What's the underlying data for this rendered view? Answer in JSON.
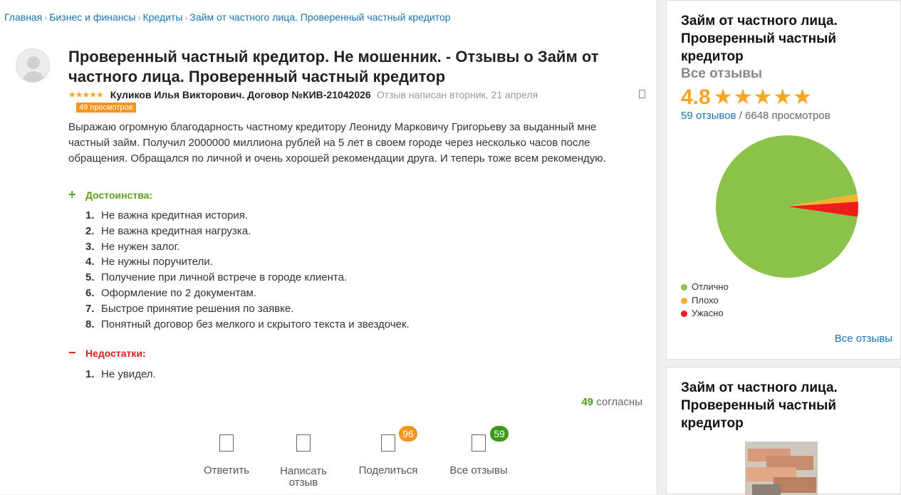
{
  "breadcrumb": [
    "Главная",
    "Бизнес и финансы",
    "Кредиты",
    "Займ от частного лица. Проверенный частный кредитор"
  ],
  "review": {
    "title": "Проверенный частный кредитор. Не мошенник. - Отзывы о Займ от частного лица. Проверенный частный кредитор",
    "stars": "★★★★★",
    "author": "Куликов Илья Викторович. Договор №КИВ-21042026",
    "written": "Отзыв написан вторник, 21 апреля",
    "views": "49 просмотров",
    "text": "Выражаю огромную благодарность частному кредитору Леониду Марковичу Григорьеву за выданный мне частный займ. Получил 2000000 миллиона рублей на 5 лет в своем городе через несколько часов после обращения. Обращался по личной и очень хорошей рекомендации друга. И теперь тоже всем рекомендую.",
    "pros_label": "Достоинства:",
    "pros_sign": "+",
    "pros": [
      "Не важна кредитная история.",
      "Не важна кредитная нагрузка.",
      "Не нужен залог.",
      "Не нужны поручители.",
      "Получение при личной встрече в городе клиента.",
      "Оформление по 2 документам.",
      "Быстрое принятие решения по заявке.",
      "Понятный договор без мелкого и скрытого текста и звездочек."
    ],
    "cons_label": "Недостатки:",
    "cons_sign": "−",
    "cons": [
      "Не увидел."
    ],
    "agree_count": "49",
    "agree_label": "согласны"
  },
  "actions": [
    {
      "label": "Ответить",
      "badge": null
    },
    {
      "label": "Написать отзыв",
      "badge": null
    },
    {
      "label": "Поделиться",
      "badge": "96",
      "badge_color": "#f7941d"
    },
    {
      "label": "Все отзывы",
      "badge": "59",
      "badge_color": "#3a9a1a"
    }
  ],
  "sidebar": {
    "title": "Займ от частного лица. Проверенный частный кредитор",
    "all_reviews_sub": "Все отзывы",
    "rating": "4.8",
    "rating_stars": "★★★★★",
    "reviews_count": "59 отзывов",
    "views_count": " / 6648 просмотров",
    "all_link": "Все отзывы",
    "card2_title": "Займ от частного лица. Проверенный частный кредитор"
  },
  "chart_data": {
    "type": "pie",
    "categories": [
      "Отлично",
      "Плохо",
      "Ужасно"
    ],
    "values": [
      56,
      1,
      2
    ],
    "colors": [
      "#8bc34a",
      "#f6b22c",
      "#ee1c1c"
    ]
  }
}
